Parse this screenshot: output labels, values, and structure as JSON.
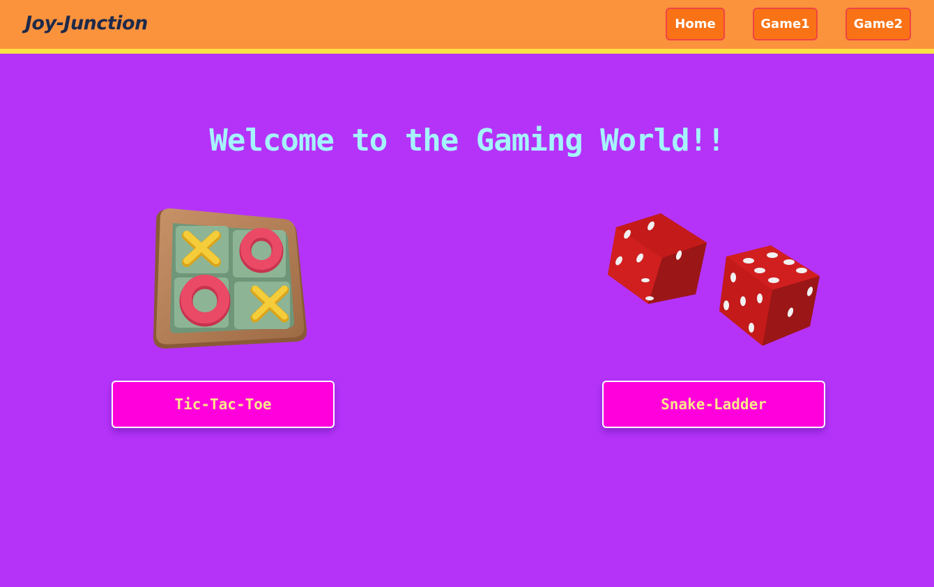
{
  "navbar": {
    "brand": "Joy-Junction",
    "links": [
      {
        "label": "Home"
      },
      {
        "label": "Game1"
      },
      {
        "label": "Game2"
      }
    ]
  },
  "main": {
    "heading": "Welcome to the Gaming World!!",
    "games": [
      {
        "label": "Tic-Tac-Toe",
        "image": "tic-tac-toe-board-icon"
      },
      {
        "label": "Snake-Ladder",
        "image": "dice-icon"
      }
    ]
  },
  "colors": {
    "page_background": "#b533f9",
    "navbar": "#fb923c",
    "navbar_stripe": "#fde047",
    "nav_button": "#f97316",
    "heading_text": "#a5f3fc",
    "game_button": "#ff00dd",
    "game_button_text": "#fde68a"
  }
}
